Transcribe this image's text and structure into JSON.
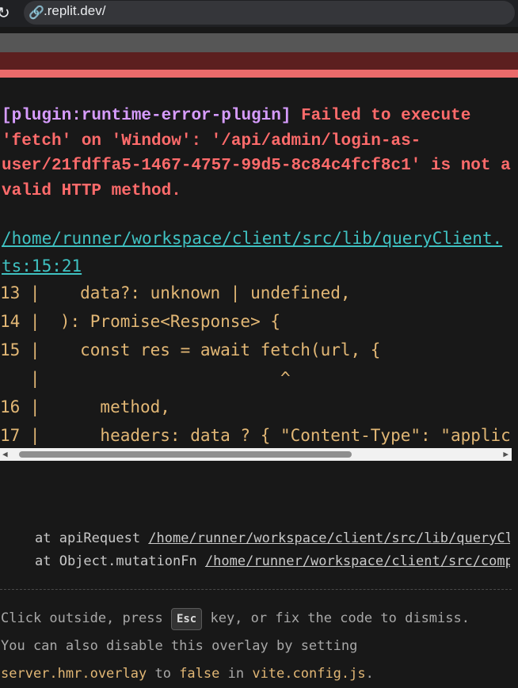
{
  "browser": {
    "url_host": ".replit.dev/",
    "reload_icon": "reload-icon",
    "link_icon": "link-icon"
  },
  "error": {
    "plugin": "[plugin:runtime-error-plugin]",
    "message": "Failed to execute 'fetch' on 'Window': '/api/admin/login-as-user/21fdffa5-1467-4757-99d5-8c84c4fcf8c1' is not a valid HTTP method.",
    "file": "/home/runner/workspace/client/src/lib/queryClient.ts:15:21"
  },
  "frame_lines": [
    "13 |    data?: unknown | undefined,",
    "14 |  ): Promise<Response> {",
    "15 |    const res = await fetch(url, {",
    "   |                        ^",
    "16 |      method,",
    "17 |      headers: data ? { \"Content-Type\": \"application/json\" } : {},"
  ],
  "stack": [
    {
      "prefix": "at apiRequest ",
      "path": "/home/runner/workspace/client/src/lib/queryClient.ts"
    },
    {
      "prefix": "at Object.mutationFn ",
      "path": "/home/runner/workspace/client/src/components"
    }
  ],
  "tip": {
    "line1_before": "Click outside, press ",
    "key": "Esc",
    "line1_after": " key, or fix the code to dismiss.",
    "line2": "You can also disable this overlay by setting",
    "line3_a": "server.hmr.overlay",
    "line3_b": " to ",
    "line3_c": "false",
    "line3_d": " in ",
    "line3_e": "vite.config.js",
    "line3_f": "."
  },
  "colors": {
    "message_red": "#ff6b6b",
    "plugin_purple": "#d79cff",
    "file_cyan": "#3fc2c2",
    "code_gold": "#e2b775",
    "band_accent": "#eb6b6b"
  }
}
